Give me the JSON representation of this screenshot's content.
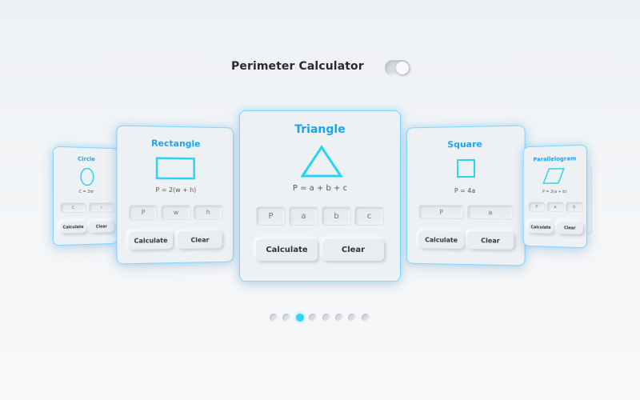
{
  "header": {
    "title": "Perimeter Calculator",
    "toggle_on": true
  },
  "cards": {
    "circle": {
      "title": "Circle",
      "formula": "C = 2πr",
      "fields": [
        "C",
        "r"
      ],
      "calculate": "Calculate",
      "clear": "Clear",
      "shape_icon": "circle-icon"
    },
    "rectangle": {
      "title": "Rectangle",
      "formula": "P = 2(w + h)",
      "fields": [
        "P",
        "w",
        "h"
      ],
      "calculate": "Calculate",
      "clear": "Clear",
      "shape_icon": "rectangle-icon"
    },
    "triangle": {
      "title": "Triangle",
      "formula": "P = a + b + c",
      "fields": [
        "P",
        "a",
        "b",
        "c"
      ],
      "calculate": "Calculate",
      "clear": "Clear",
      "shape_icon": "triangle-icon"
    },
    "square": {
      "title": "Square",
      "formula": "P = 4a",
      "fields": [
        "P",
        "a"
      ],
      "calculate": "Calculate",
      "clear": "Clear",
      "shape_icon": "square-icon"
    },
    "parallelogram": {
      "title": "Parallelogram",
      "formula": "P = 2(a + b)",
      "fields": [
        "P",
        "a",
        "b"
      ],
      "calculate": "Calculate",
      "clear": "Clear",
      "shape_icon": "parallelogram-icon"
    }
  },
  "pagination": {
    "count": 8,
    "active_index": 2
  },
  "colors": {
    "accent": "#1aa3f0",
    "shape_stroke": "#27d3f2",
    "card_border": "#7fd6ff",
    "active_dot": "#2fd3f5"
  }
}
